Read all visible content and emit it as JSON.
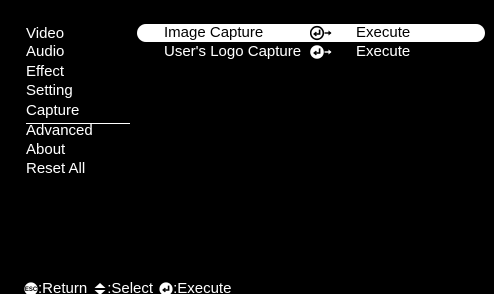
{
  "menu": {
    "items": [
      "Video",
      "Audio",
      "Effect",
      "Setting",
      "Capture",
      "Advanced",
      "About",
      "Reset All"
    ],
    "active": "Capture"
  },
  "submenu": {
    "rows": [
      {
        "label": "Image Capture",
        "icon": "enter-icon",
        "value": "Execute",
        "highlighted": true
      },
      {
        "label": "User's Logo Capture",
        "icon": "enter-icon",
        "value": "Execute",
        "highlighted": false
      }
    ]
  },
  "footer": {
    "return_label": ":Return",
    "select_label": ":Select",
    "execute_label": ":Execute",
    "return_icon": "esc-icon",
    "select_icon": "up-down-arrows-icon",
    "execute_icon": "enter-icon"
  },
  "colors": {
    "background": "#000000",
    "text": "#ffffff",
    "highlight_bar": "#ffffff",
    "highlight_text": "#000000"
  }
}
